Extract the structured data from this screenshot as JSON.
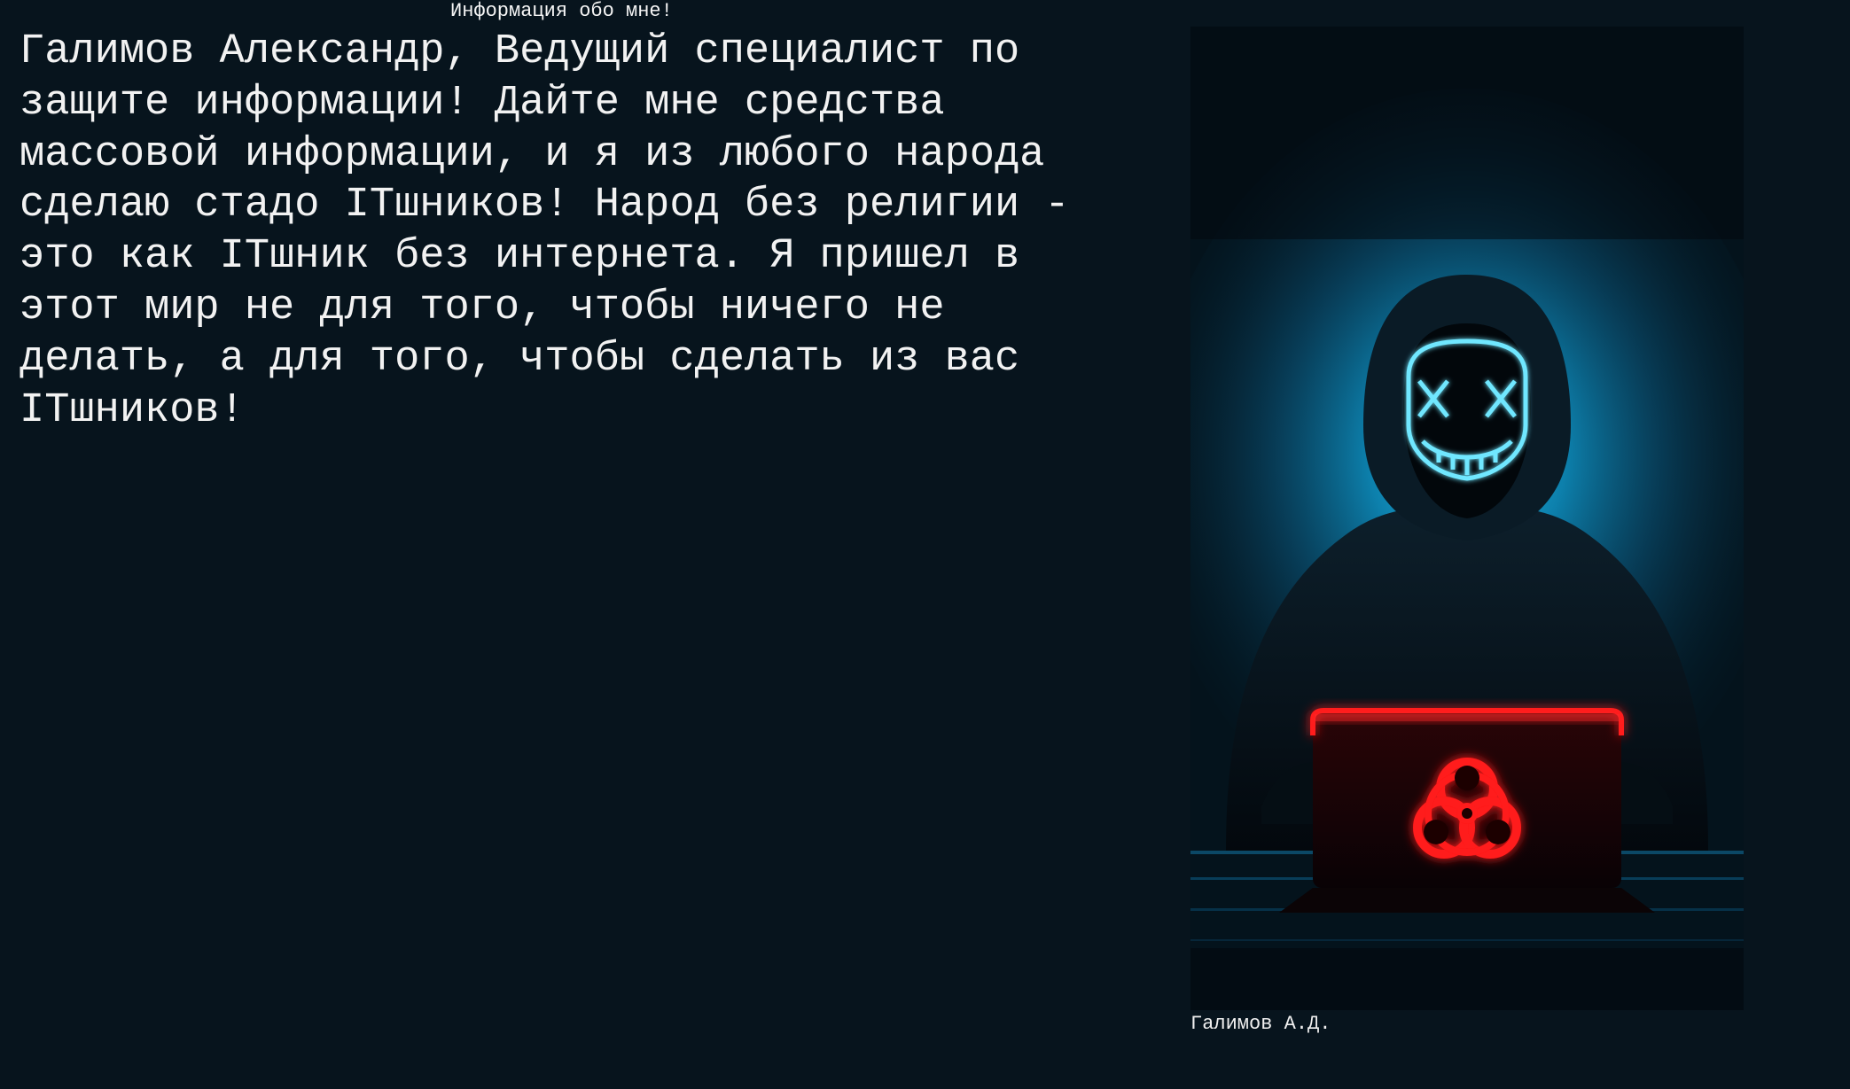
{
  "header": {
    "title": "Информация обо мне!"
  },
  "about": {
    "text": "Галимов Александр, Ведущий специалист по\nзащите информации! Дайте мне средства\nмассовой информации, и я из любого народа\nсделаю стадо IТшников! Народ без религии -\nэто как IТшник без интернета. Я пришел в\nэтот мир не для того, чтобы ничего не\nделать, а для того, чтобы сделать из вас\nIТшников!"
  },
  "portrait": {
    "caption": "Галимов А.Д.",
    "subject": "hooded-figure-with-neon-mask",
    "colors": {
      "glow": "#18a9de",
      "neon_red": "#ff1a1a",
      "mask_blue": "#6fe7ff",
      "background": "#07141d"
    }
  }
}
